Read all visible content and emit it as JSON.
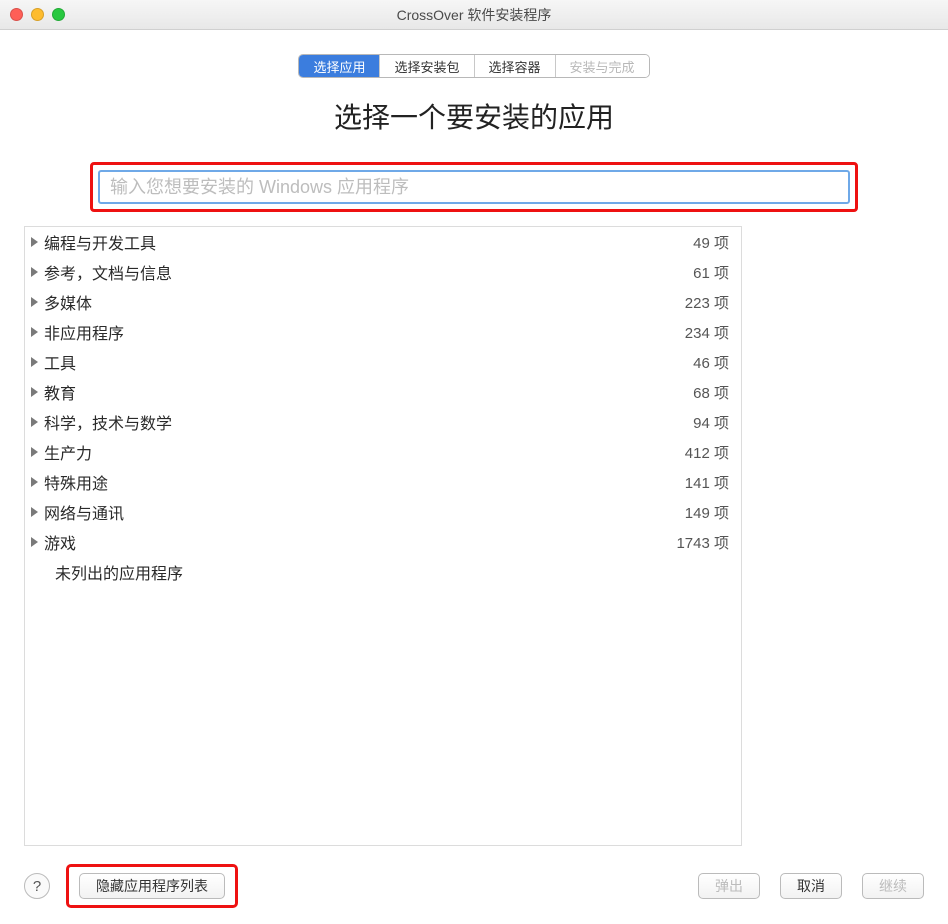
{
  "window": {
    "title": "CrossOver 软件安装程序"
  },
  "segments": [
    {
      "label": "选择应用",
      "state": "active"
    },
    {
      "label": "选择安装包",
      "state": "normal"
    },
    {
      "label": "选择容器",
      "state": "normal"
    },
    {
      "label": "安装与完成",
      "state": "disabled"
    }
  ],
  "headline": "选择一个要安装的应用",
  "search": {
    "placeholder": "输入您想要安装的 Windows 应用程序",
    "value": ""
  },
  "unit_suffix": " 项",
  "categories": [
    {
      "label": "编程与开发工具",
      "count": 49
    },
    {
      "label": "参考，文档与信息",
      "count": 61
    },
    {
      "label": "多媒体",
      "count": 223
    },
    {
      "label": "非应用程序",
      "count": 234
    },
    {
      "label": "工具",
      "count": 46
    },
    {
      "label": "教育",
      "count": 68
    },
    {
      "label": "科学，技术与数学",
      "count": 94
    },
    {
      "label": "生产力",
      "count": 412
    },
    {
      "label": "特殊用途",
      "count": 141
    },
    {
      "label": "网络与通讯",
      "count": 149
    },
    {
      "label": "游戏",
      "count": 1743
    }
  ],
  "unlisted_label": "未列出的应用程序",
  "footer": {
    "help": "?",
    "hide_list": "隐藏应用程序列表",
    "eject": "弹出",
    "cancel": "取消",
    "continue": "继续"
  }
}
